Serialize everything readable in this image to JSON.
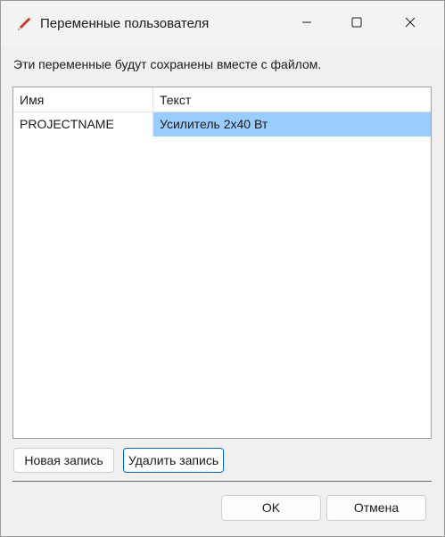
{
  "window": {
    "title": "Переменные пользователя",
    "icon": "pencil-icon"
  },
  "description": "Эти переменные будут сохранены вместе с файлом.",
  "table": {
    "columns": [
      "Имя",
      "Текст"
    ],
    "rows": [
      {
        "name": "PROJECTNAME",
        "text": "Усилитель 2x40 Вт",
        "selected_cell": "text"
      }
    ],
    "selection_color": "#99ccff"
  },
  "buttons": {
    "new_record": "Новая запись",
    "delete_record": "Удалить запись",
    "ok": "OK",
    "cancel": "Отмена"
  },
  "colors": {
    "focus_border": "#0067c0",
    "background": "#f0f0f0"
  }
}
